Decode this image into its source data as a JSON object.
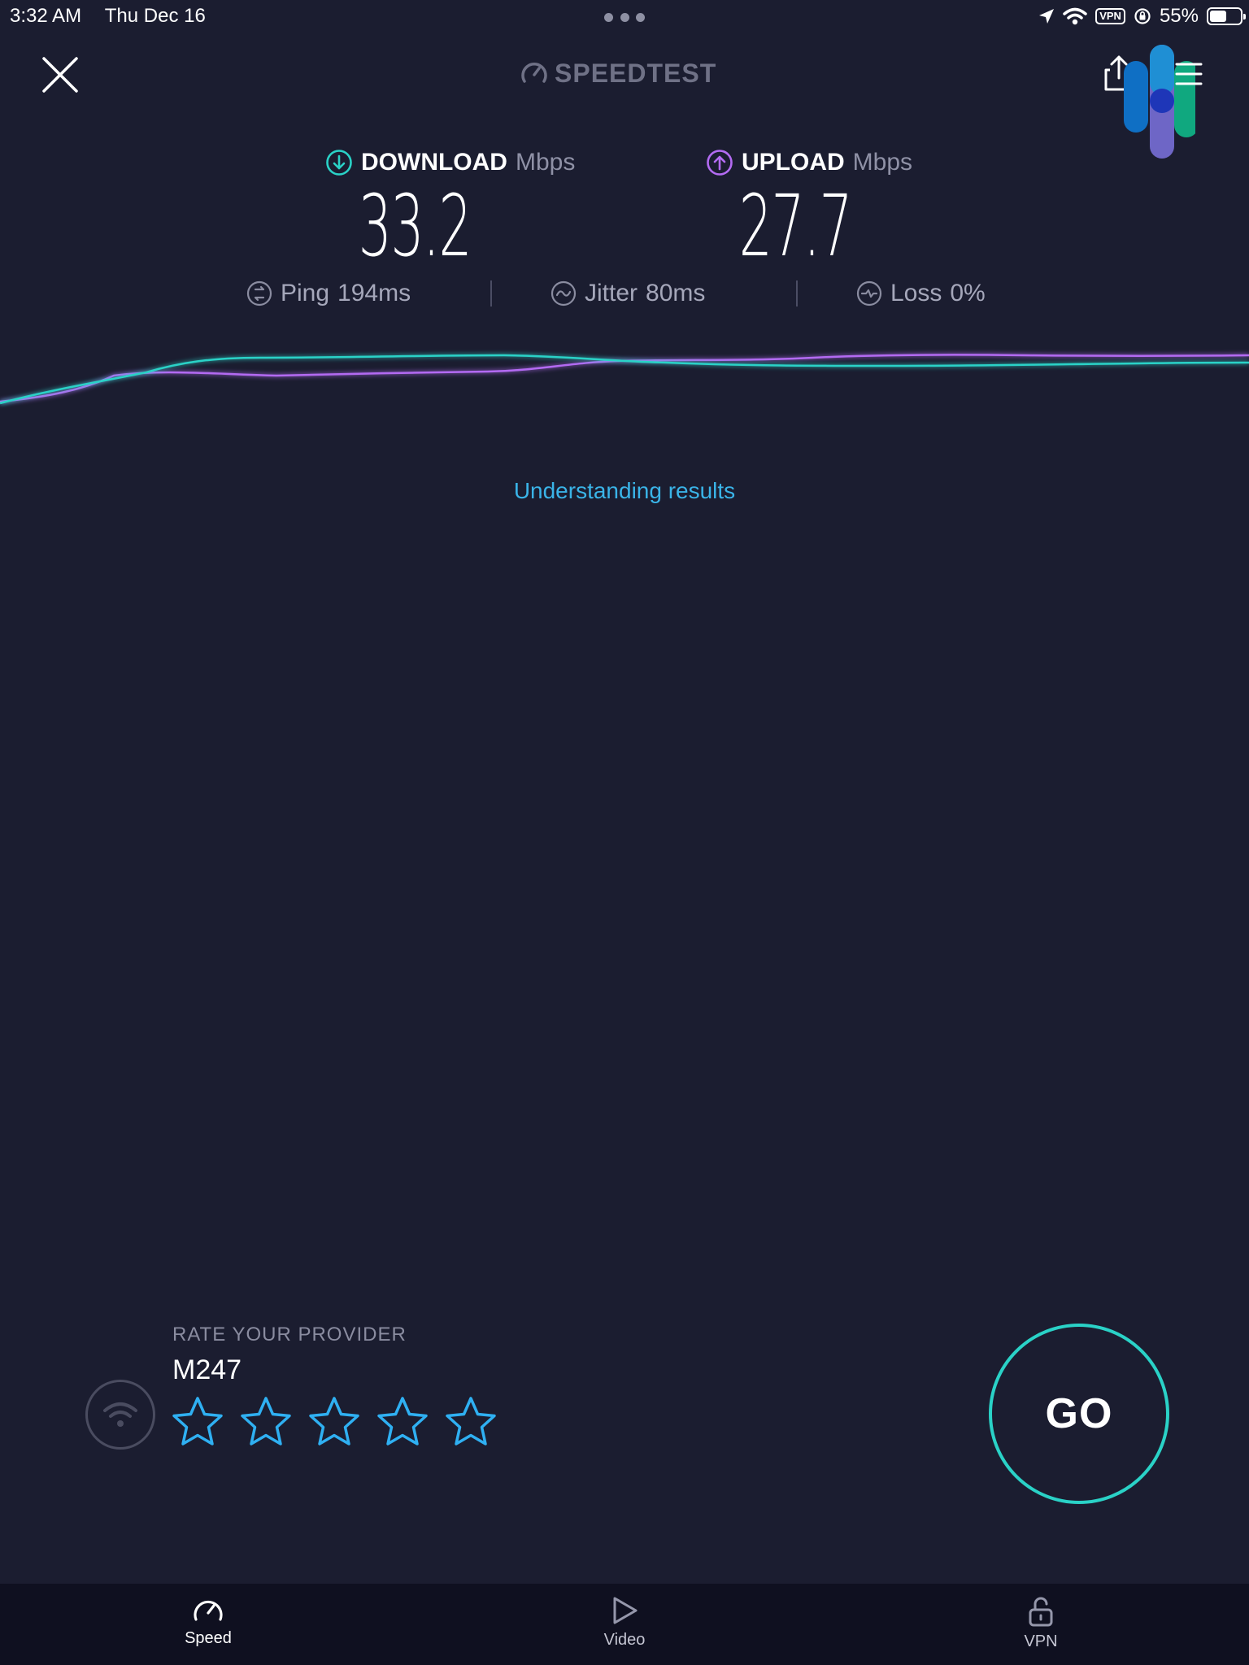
{
  "status_bar": {
    "time": "3:32 AM",
    "date": "Thu Dec 16",
    "vpn_label": "VPN",
    "battery_percent": "55%",
    "battery_level": 0.55
  },
  "header": {
    "brand": "SPEEDTEST",
    "icons": [
      "close-icon",
      "gauge-icon",
      "share-icon",
      "menu-icon"
    ]
  },
  "metrics": {
    "download": {
      "label": "DOWNLOAD",
      "unit": "Mbps",
      "value": "33.2",
      "color": "#2ad2c7"
    },
    "upload": {
      "label": "UPLOAD",
      "unit": "Mbps",
      "value": "27.7",
      "color": "#b36bf2"
    }
  },
  "stats": {
    "ping": {
      "label": "Ping",
      "value": "194",
      "unit": "ms"
    },
    "jitter": {
      "label": "Jitter",
      "value": "80",
      "unit": "ms"
    },
    "loss": {
      "label": "Loss",
      "value": "0%"
    }
  },
  "links": {
    "understanding": "Understanding results"
  },
  "provider": {
    "rate_label": "RATE YOUR PROVIDER",
    "name": "M247",
    "stars_total": 5,
    "stars_filled": 0,
    "star_color": "#2fb0f2"
  },
  "go_button": {
    "label": "GO",
    "color": "#2ad2c7"
  },
  "tabs": [
    {
      "label": "Speed",
      "icon": "speedometer-icon",
      "active": true
    },
    {
      "label": "Video",
      "icon": "play-icon",
      "active": false
    },
    {
      "label": "VPN",
      "icon": "unlock-icon",
      "active": false
    }
  ]
}
